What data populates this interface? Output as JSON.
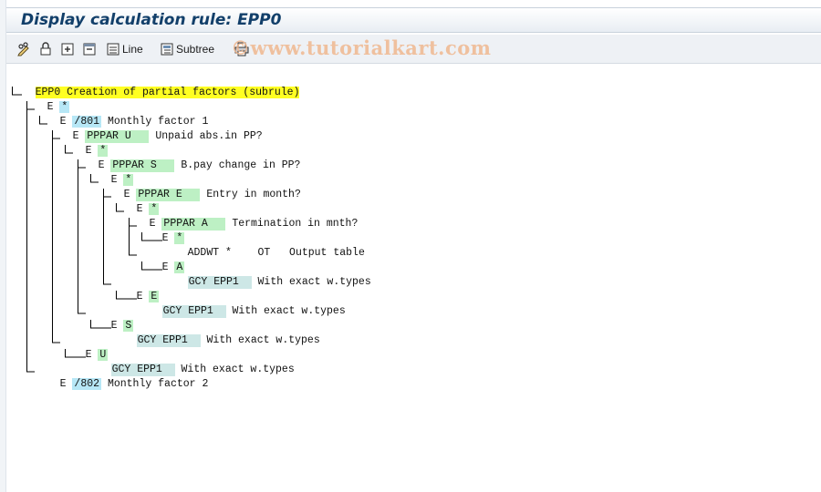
{
  "title": "Display calculation rule: EPP0",
  "toolbar": {
    "buttons": [
      {
        "icon": "pencil-glasses-icon"
      },
      {
        "icon": "other-object-icon"
      },
      {
        "icon": "new-node-icon"
      },
      {
        "icon": "delete-icon"
      },
      {
        "icon": "line-icon",
        "label": "Line"
      },
      {
        "icon": "subtree-icon",
        "label": "Subtree"
      },
      {
        "icon": "print-icon"
      }
    ],
    "watermark": "©www.tutorialkart.com"
  },
  "tree": {
    "root": {
      "code": "EPP0",
      "text": "Creation of partial factors (subrule)"
    },
    "nodes": {
      "n1": {
        "toggle": "E",
        "key": "*"
      },
      "n2": {
        "toggle": "E",
        "key": "/801",
        "text": "Monthly factor 1"
      },
      "n3": {
        "toggle": "E",
        "key": "PPPAR U",
        "text": "Unpaid abs.in PP?"
      },
      "n4": {
        "toggle": "E",
        "key": "*"
      },
      "n5": {
        "toggle": "E",
        "key": "PPPAR S",
        "text": "B.pay change in PP?"
      },
      "n6": {
        "toggle": "E",
        "key": "*"
      },
      "n7": {
        "toggle": "E",
        "key": "PPPAR E",
        "text": "Entry in month?"
      },
      "n8": {
        "toggle": "E",
        "key": "*"
      },
      "n9": {
        "toggle": "E",
        "key": "PPPAR A",
        "text": "Termination in mnth?"
      },
      "n10": {
        "toggle": "E",
        "key": "*"
      },
      "n11": {
        "key": "ADDWT *",
        "extra": "OT",
        "text": "Output table"
      },
      "n12": {
        "toggle": "E",
        "key": "A"
      },
      "n13": {
        "key": "GCY EPP1",
        "text": "With exact w.types"
      },
      "n14": {
        "toggle": "E",
        "key": "E"
      },
      "n15": {
        "key": "GCY EPP1",
        "text": "With exact w.types"
      },
      "n16": {
        "toggle": "E",
        "key": "S"
      },
      "n17": {
        "key": "GCY EPP1",
        "text": "With exact w.types"
      },
      "n18": {
        "toggle": "E",
        "key": "U"
      },
      "n19": {
        "key": "GCY EPP1",
        "text": "With exact w.types"
      },
      "n20": {
        "toggle": "E",
        "key": "/802",
        "text": "Monthly factor 2"
      }
    }
  },
  "colors": {
    "title": "#123f6a",
    "root_highlight": "#ffff22",
    "key_blue": "#b7e7f6",
    "key_green": "#bdf0c4",
    "key_teal": "#cde7e6"
  }
}
